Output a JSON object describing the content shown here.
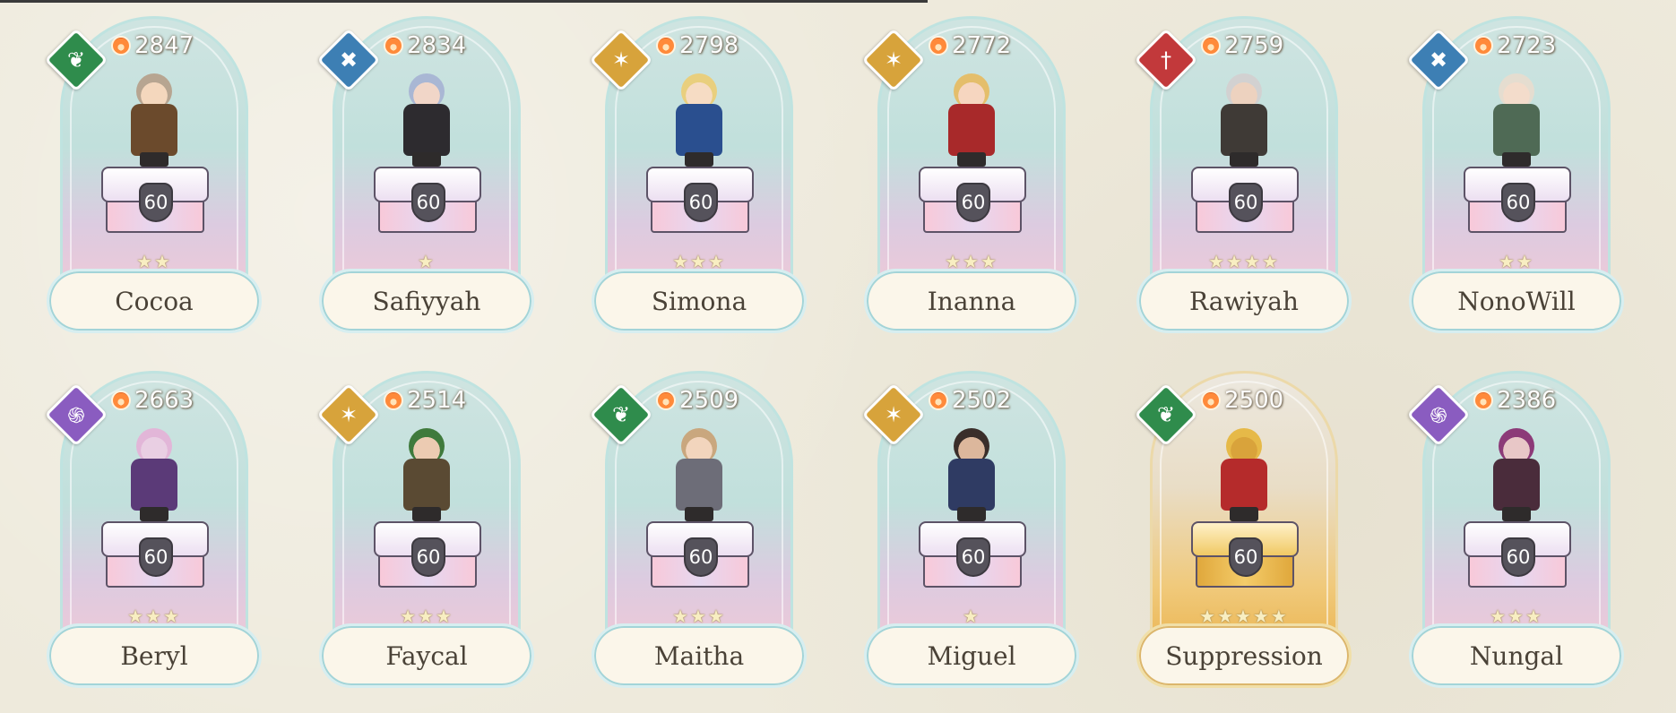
{
  "heroes": [
    {
      "name": "Cocoa",
      "power": "2847",
      "level": "60",
      "stars": 2,
      "element": "green",
      "element_icon": "leaf-shield-icon",
      "skin": "#f4d7bd",
      "outfit": "#6b4a2c",
      "hair": "#b7a591",
      "rarity": "normal"
    },
    {
      "name": "Safiyyah",
      "power": "2834",
      "level": "60",
      "stars": 1,
      "element": "blue",
      "element_icon": "crossed-swords-icon",
      "skin": "#f1d6c8",
      "outfit": "#2d2b2f",
      "hair": "#a9b7d4",
      "rarity": "normal"
    },
    {
      "name": "Simona",
      "power": "2798",
      "level": "60",
      "stars": 3,
      "element": "gold",
      "element_icon": "sun-compass-icon",
      "skin": "#f6dcc4",
      "outfit": "#2a4f8f",
      "hair": "#e9cf7e",
      "rarity": "normal"
    },
    {
      "name": "Inanna",
      "power": "2772",
      "level": "60",
      "stars": 3,
      "element": "gold",
      "element_icon": "sun-compass-icon",
      "skin": "#f6d6c0",
      "outfit": "#a8292a",
      "hair": "#e4be6b",
      "rarity": "normal"
    },
    {
      "name": "Rawiyah",
      "power": "2759",
      "level": "60",
      "stars": 4,
      "element": "red",
      "element_icon": "sword-icon",
      "skin": "#edd2bf",
      "outfit": "#3f3a36",
      "hair": "#d2d1d1",
      "rarity": "normal"
    },
    {
      "name": "NonoWill",
      "power": "2723",
      "level": "60",
      "stars": 2,
      "element": "blue",
      "element_icon": "crossed-swords-icon",
      "skin": "#f3dccb",
      "outfit": "#4f6a55",
      "hair": "#e5ddd0",
      "rarity": "normal"
    },
    {
      "name": "Beryl",
      "power": "2663",
      "level": "60",
      "stars": 3,
      "element": "purple",
      "element_icon": "spiral-orb-icon",
      "skin": "#e9cfe3",
      "outfit": "#5b3a78",
      "hair": "#e2b6d8",
      "rarity": "normal"
    },
    {
      "name": "Faycal",
      "power": "2514",
      "level": "60",
      "stars": 3,
      "element": "gold",
      "element_icon": "sun-compass-icon",
      "skin": "#eccbb2",
      "outfit": "#5a4a33",
      "hair": "#3f7a3c",
      "rarity": "normal"
    },
    {
      "name": "Maitha",
      "power": "2509",
      "level": "60",
      "stars": 3,
      "element": "green",
      "element_icon": "leaf-shield-icon",
      "skin": "#f2d5bd",
      "outfit": "#6d6d78",
      "hair": "#c9a77e",
      "rarity": "normal"
    },
    {
      "name": "Miguel",
      "power": "2502",
      "level": "60",
      "stars": 1,
      "element": "gold",
      "element_icon": "sun-compass-icon",
      "skin": "#dcb79c",
      "outfit": "#2f3b63",
      "hair": "#3a2e2a",
      "rarity": "normal"
    },
    {
      "name": "Suppression",
      "power": "2500",
      "level": "60",
      "stars": 5,
      "element": "green",
      "element_icon": "leaf-shield-icon",
      "skin": "#d9a33b",
      "outfit": "#b52b2b",
      "hair": "#e6b948",
      "rarity": "gold"
    },
    {
      "name": "Nungal",
      "power": "2386",
      "level": "60",
      "stars": 3,
      "element": "purple",
      "element_icon": "spiral-orb-icon",
      "skin": "#e8c7c7",
      "outfit": "#4a2c3b",
      "hair": "#8c3a78",
      "rarity": "normal"
    }
  ],
  "colors": {
    "background": "#eeeadc",
    "frame_border": "#bfe3e0",
    "name_text": "#4a4237",
    "power_text": "#ffffff"
  }
}
